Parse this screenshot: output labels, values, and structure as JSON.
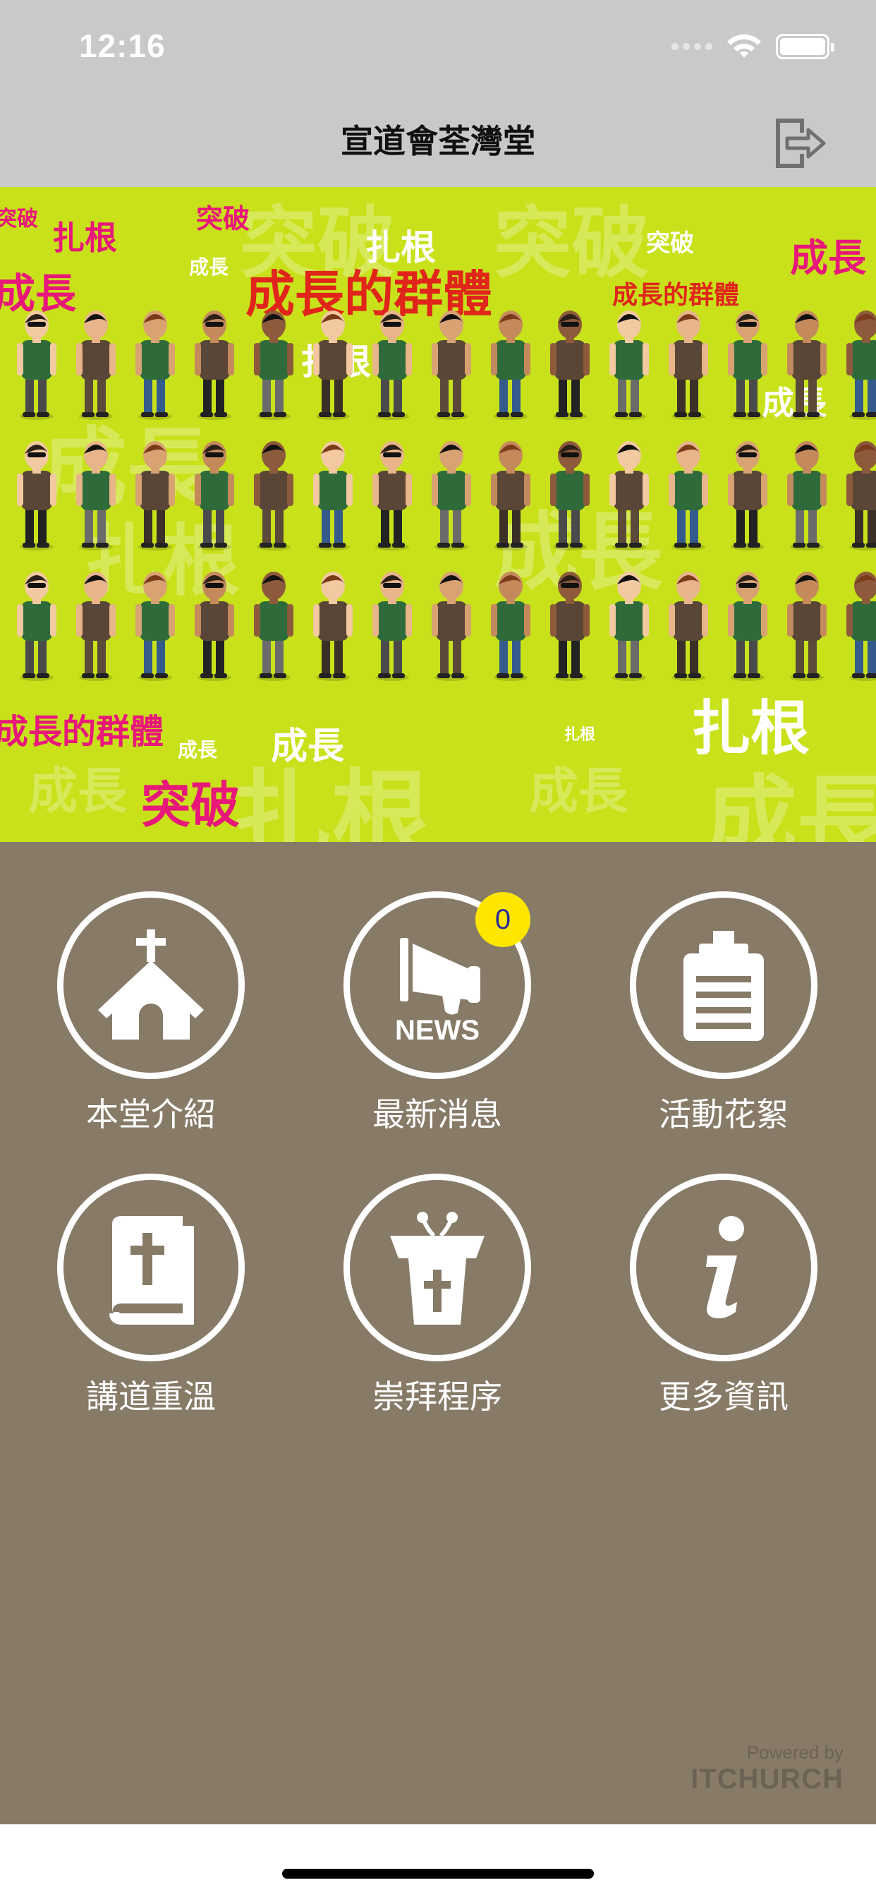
{
  "status_bar": {
    "time": "12:16"
  },
  "nav": {
    "title": "宣道會荃灣堂",
    "logout_icon": "logout-icon"
  },
  "banner": {
    "words": [
      "突破",
      "扎根",
      "成長",
      "成長的群體",
      "扎根",
      "突破",
      "成長",
      "成長的群體",
      "扎根",
      "突破",
      "成長",
      "成長的群體",
      "扎根",
      "突破",
      "成長",
      "扎根",
      "成長"
    ]
  },
  "menu": {
    "items": [
      {
        "label": "本堂介紹",
        "icon": "church-icon"
      },
      {
        "label": "最新消息",
        "icon": "news-megaphone-icon",
        "badge": "0"
      },
      {
        "label": "活動花絮",
        "icon": "clipboard-icon"
      },
      {
        "label": "講道重溫",
        "icon": "bible-icon"
      },
      {
        "label": "崇拜程序",
        "icon": "pulpit-icon"
      },
      {
        "label": "更多資訊",
        "icon": "info-icon"
      }
    ]
  },
  "footer": {
    "powered_by": "Powered by",
    "brand": "ITCHURCH"
  },
  "colors": {
    "background": "#877b68",
    "banner": "#c8e11a",
    "badge": "#ffe600",
    "nav": "#c9c9c9"
  }
}
